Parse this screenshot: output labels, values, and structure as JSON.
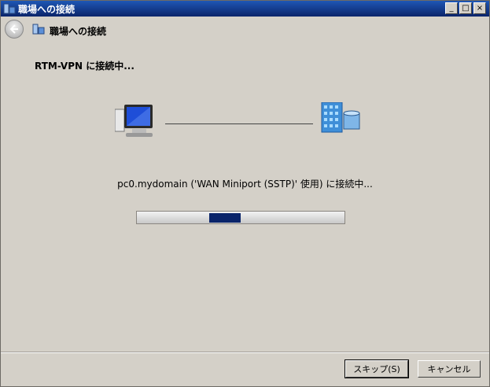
{
  "window": {
    "title": "職場への接続",
    "controls": {
      "minimize": "_",
      "maximize": "□",
      "close": "×"
    }
  },
  "navbar": {
    "title": "職場への接続",
    "back_icon": "back-arrow-icon"
  },
  "content": {
    "heading": "RTM-VPN に接続中...",
    "status": "pc0.mydomain ('WAN Miniport (SSTP)' 使用) に接続中...",
    "progress": {
      "indeterminate": true,
      "fill_fraction": 0.15,
      "fill_offset_fraction": 0.35
    },
    "icons": {
      "left": "computer-icon",
      "right": "server-icon"
    }
  },
  "buttons": {
    "skip": "スキップ(S)",
    "cancel": "キャンセル"
  },
  "colors": {
    "accent": "#0a246a",
    "background": "#d4d0c8"
  }
}
